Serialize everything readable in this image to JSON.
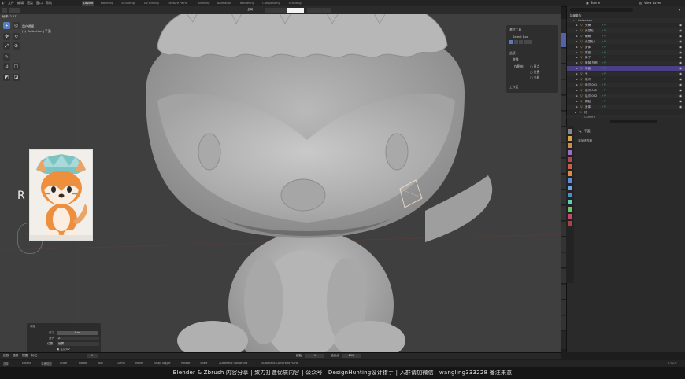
{
  "menu": {
    "items": [
      "文件",
      "编辑",
      "渲染",
      "窗口",
      "帮助"
    ],
    "workspace_tabs": [
      "Layout",
      "Modeling",
      "Sculpting",
      "UV Editing",
      "Texture Paint",
      "Shading",
      "Animation",
      "Rendering",
      "Compositing",
      "Scripting"
    ],
    "active_tab": "Layout",
    "scene_label": "Scene",
    "view_layer_label": "View Layer"
  },
  "viewport": {
    "header_mode": "物体模式",
    "view_name": "用户透视",
    "collection_info": "(1) Collection | 平面",
    "fps": "帧率: 2.27",
    "global_label": "全局",
    "overlay_key": "R"
  },
  "npanel": {
    "section1_title": "激活工具",
    "select_box": "Select Box",
    "section2_title": "选项",
    "transform_label": "变换",
    "affect_only": "仅影响",
    "opt1": "原点",
    "opt2": "位置",
    "opt3": "父级",
    "workspace_title": "工作区"
  },
  "outliner": {
    "search_placeholder": "",
    "title": "场景集合",
    "collection": "Collection",
    "rows": [
      {
        "name": "头骨",
        "sel": false
      },
      {
        "name": "头顶毛",
        "sel": false
      },
      {
        "name": "眼睛",
        "sel": false
      },
      {
        "name": "头顶毛2",
        "sel": false
      },
      {
        "name": "身体",
        "sel": false
      },
      {
        "name": "尾巴",
        "sel": false
      },
      {
        "name": "鼻子",
        "sel": false
      },
      {
        "name": "脸部.左侧",
        "sel": false
      },
      {
        "name": "平面",
        "sel": true
      },
      {
        "name": "头",
        "sel": false
      },
      {
        "name": "前爪",
        "sel": false
      },
      {
        "name": "前爪.001",
        "sel": false
      },
      {
        "name": "前爪.002",
        "sel": false
      },
      {
        "name": "后爪.002",
        "sel": false
      },
      {
        "name": "脚趾",
        "sel": false
      },
      {
        "name": "身体",
        "sel": false
      }
    ],
    "footer_row": "灯",
    "footer_row2": "Camera"
  },
  "properties": {
    "object_name": "平面",
    "subtitle": "添加修改器"
  },
  "operator": {
    "title": "添加",
    "size_label": "尺寸",
    "size_value": "1 m",
    "align_label": "对齐",
    "align_value": "Z",
    "location_label": "位置",
    "location_value": "世界",
    "rotation_label": "旋转",
    "checkbox_label": "生成UV"
  },
  "timeline": {
    "playback": "回放",
    "keying": "插帧",
    "view": "视图",
    "marker": "标记",
    "start_label": "起始",
    "start_value": "1",
    "end_label": "结束点",
    "end_value": "250",
    "current_frame": "1"
  },
  "status": {
    "items": [
      "选择",
      "Extend",
      "平移视图",
      "Scale",
      "Rotate",
      "Tool",
      "Gizmo",
      "Move",
      "Snap Toggle",
      "Rotate",
      "Scale",
      "Automatic Constraint",
      "Automatic Constraint Plane"
    ],
    "version": "2.92.0"
  },
  "caption": {
    "text": "Blender & Zbrush 内容分享  |  致力打造优质内容  |  公众号：DesignHunting设计猎手  |  入群请加微信：wangling333228 备注来意"
  }
}
